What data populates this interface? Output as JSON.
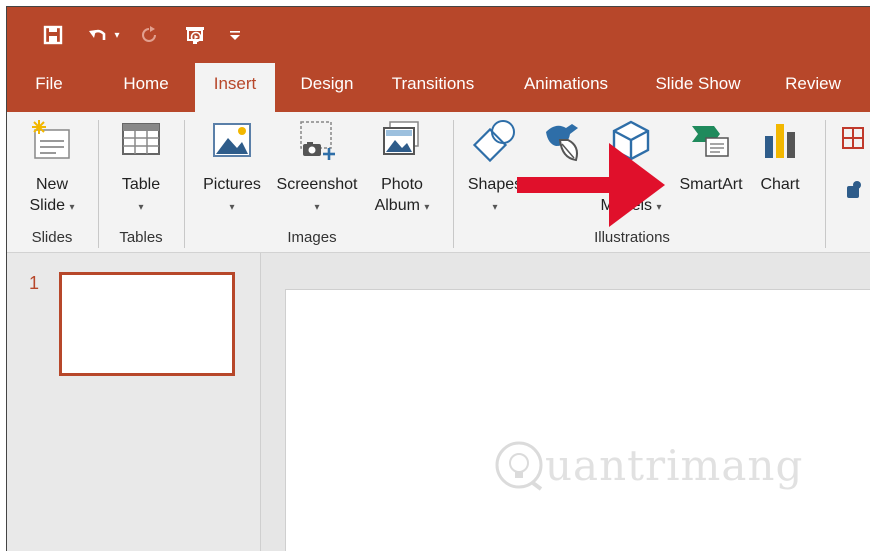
{
  "colors": {
    "accent": "#b7472a",
    "ribbon_bg": "#f3f3f3",
    "arrow": "#e0102b"
  },
  "quick_access": {
    "icons": [
      "save-icon",
      "undo-icon",
      "redo-icon",
      "start-from-beginning-icon",
      "customize-qat-icon"
    ]
  },
  "tabs": [
    "File",
    "Home",
    "Insert",
    "Design",
    "Transitions",
    "Animations",
    "Slide Show",
    "Review"
  ],
  "active_tab": "Insert",
  "ribbon": {
    "new_slide": {
      "line1": "New",
      "line2": "Slide"
    },
    "table": {
      "line1": "Table"
    },
    "pictures": {
      "line1": "Pictures"
    },
    "screenshot": {
      "line1": "Screenshot"
    },
    "photo_album": {
      "line1": "Photo",
      "line2": "Album"
    },
    "shapes": {
      "line1": "Shapes"
    },
    "models": {
      "line2": "Models"
    },
    "smartart": {
      "line1": "SmartArt"
    },
    "chart": {
      "line1": "Chart"
    },
    "groups": {
      "slides": "Slides",
      "tables": "Tables",
      "images": "Images",
      "illustrations": "Illustrations"
    },
    "caret": "▾"
  },
  "slides_panel": {
    "thumb_number": "1"
  },
  "watermark": {
    "text": "uantrimang"
  }
}
